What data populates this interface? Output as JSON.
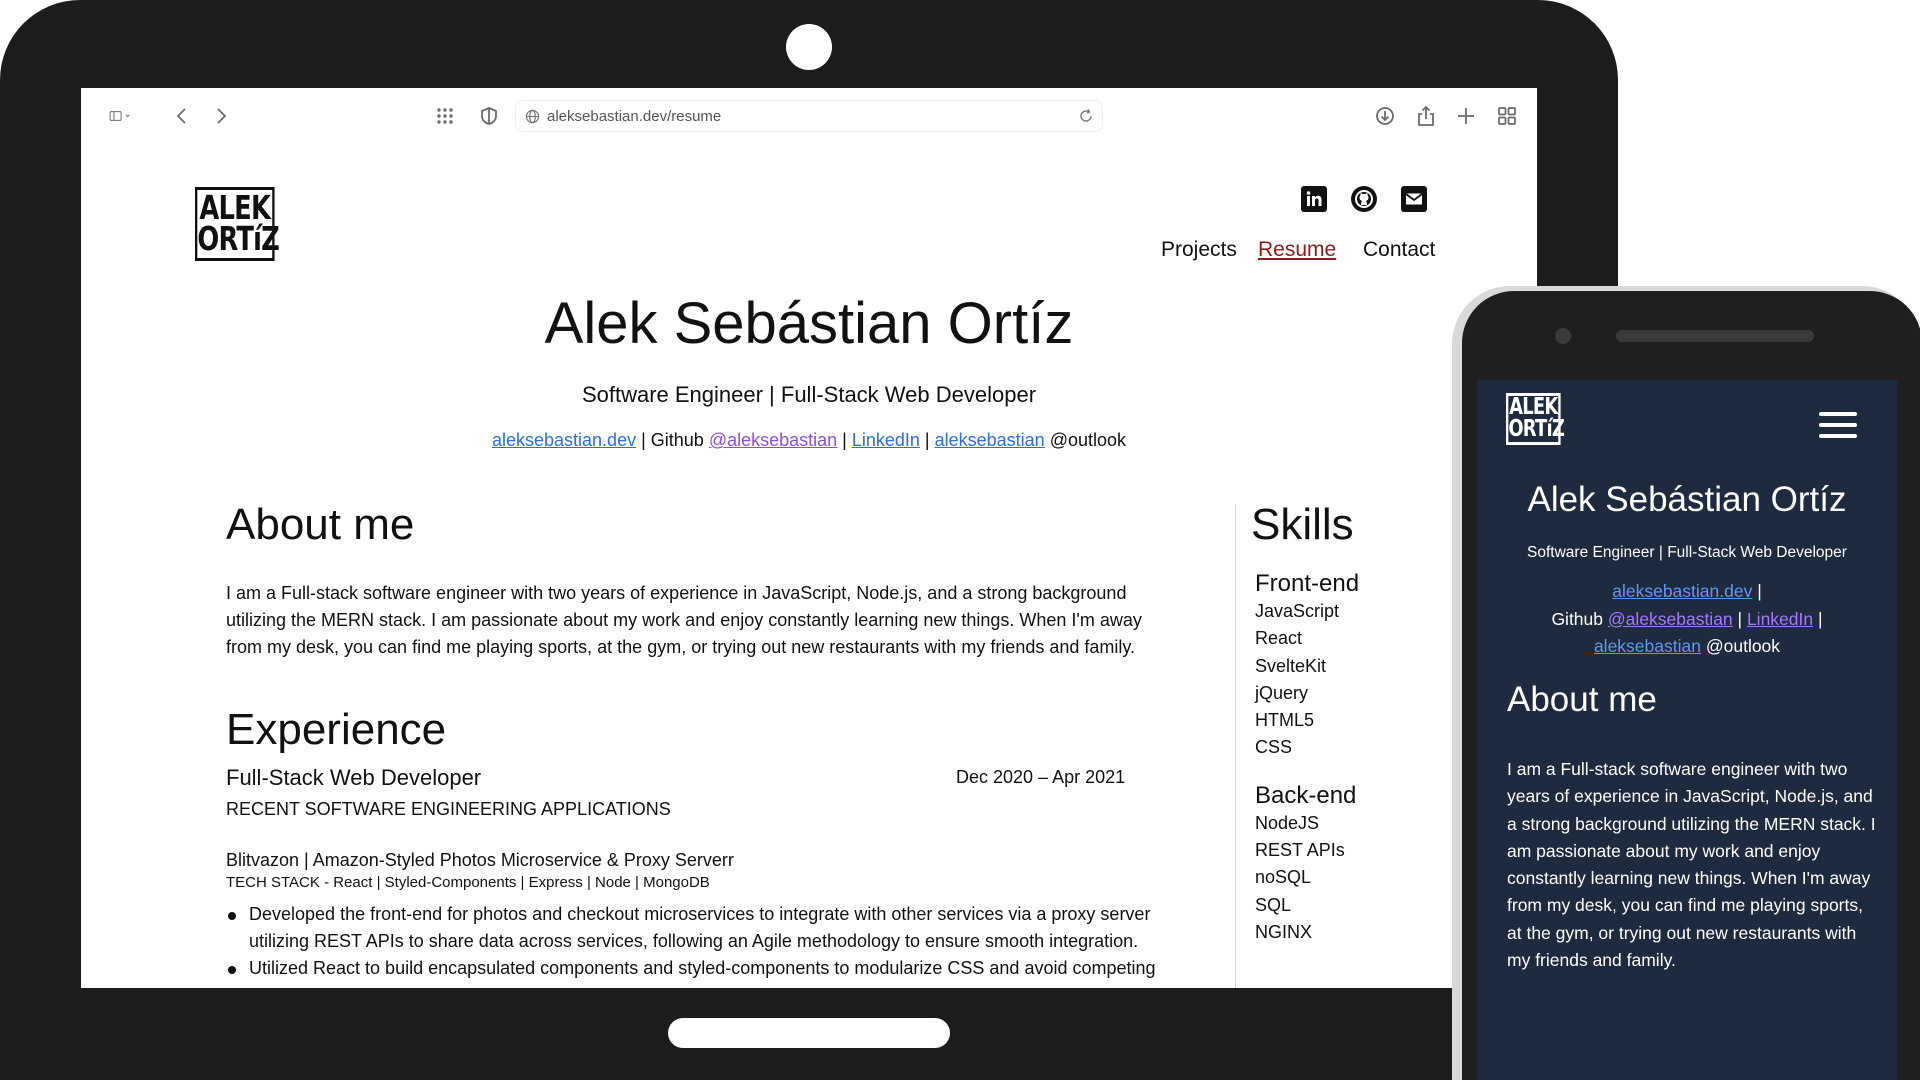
{
  "browser": {
    "url": "aleksebastian.dev/resume"
  },
  "logo": {
    "line1": "ALEK",
    "line2": "ORTíZ"
  },
  "nav": {
    "projects": "Projects",
    "resume": "Resume",
    "contact": "Contact"
  },
  "hero": {
    "name": "Alek Sebástian Ortíz",
    "subtitle": "Software Engineer | Full-Stack Web Developer",
    "site_link": "aleksebastian.dev",
    "sep1": " | Github ",
    "github_link": "@aleksebastian",
    "sep2": " | ",
    "linkedin_link": "LinkedIn",
    "sep3": " | ",
    "email_link": "aleksebastian",
    "email_suffix": " @outlook"
  },
  "about": {
    "title": "About me",
    "text": "I am a Full-stack software engineer with two years of experience in JavaScript, Node.js, and a strong background utilizing the MERN stack. I am passionate about my work and enjoy constantly learning new things. When I'm away from my desk, you can find me playing sports, at the gym, or trying out new restaurants with my friends and family."
  },
  "experience": {
    "title": "Experience",
    "role": "Full-Stack Web Developer",
    "dates": "Dec 2020 – Apr 2021",
    "category": "RECENT SOFTWARE ENGINEERING APPLICATIONS",
    "project_name": "Blitvazon | Amazon-Styled Photos Microservice & Proxy Serverr",
    "tech_stack": "TECH STACK - React | Styled-Components | Express | Node | MongoDB",
    "bullets": [
      "Developed the front-end for photos and checkout microservices to integrate with other services via a proxy server utilizing REST APIs to share data across services, following an Agile methodology to ensure smooth integration.",
      "Utilized React to build encapsulated components and styled-components to modularize CSS and avoid competing"
    ]
  },
  "skills": {
    "title": "Skills",
    "groups": [
      {
        "title": "Front-end",
        "items": [
          "JavaScript",
          "React",
          "SvelteKit",
          "jQuery",
          "HTML5",
          "CSS"
        ]
      },
      {
        "title": "Back-end",
        "items": [
          "NodeJS",
          "REST APIs",
          "noSQL",
          "SQL",
          "NGINX"
        ]
      }
    ]
  },
  "mobile": {
    "name": "Alek Sebástian Ortíz",
    "subtitle": "Software Engineer | Full-Stack Web Developer",
    "site_link": "aleksebastian.dev",
    "sep1": " |",
    "github_prefix": "Github ",
    "github_link": "@aleksebastian",
    "sep2": " | ",
    "linkedin_link": "LinkedIn",
    "sep3": " |",
    "email_link": "aleksebastian",
    "email_suffix": " @outlook",
    "about_title": "About me",
    "about_text": "I am a Full-stack software engineer with two years of experience in JavaScript, Node.js, and a strong background utilizing the MERN stack. I am passionate about my work and enjoy constantly learning new things. When I'm away from my desk, you can find me playing sports, at the gym, or trying out new restaurants with my friends and family."
  },
  "colors": {
    "nav_active": "#8a1c1c",
    "link": "#2a6fdb",
    "link_visited": "#8e4fd8",
    "device_frame": "#1c1c1c",
    "mobile_bg": "#1e2a3e"
  }
}
